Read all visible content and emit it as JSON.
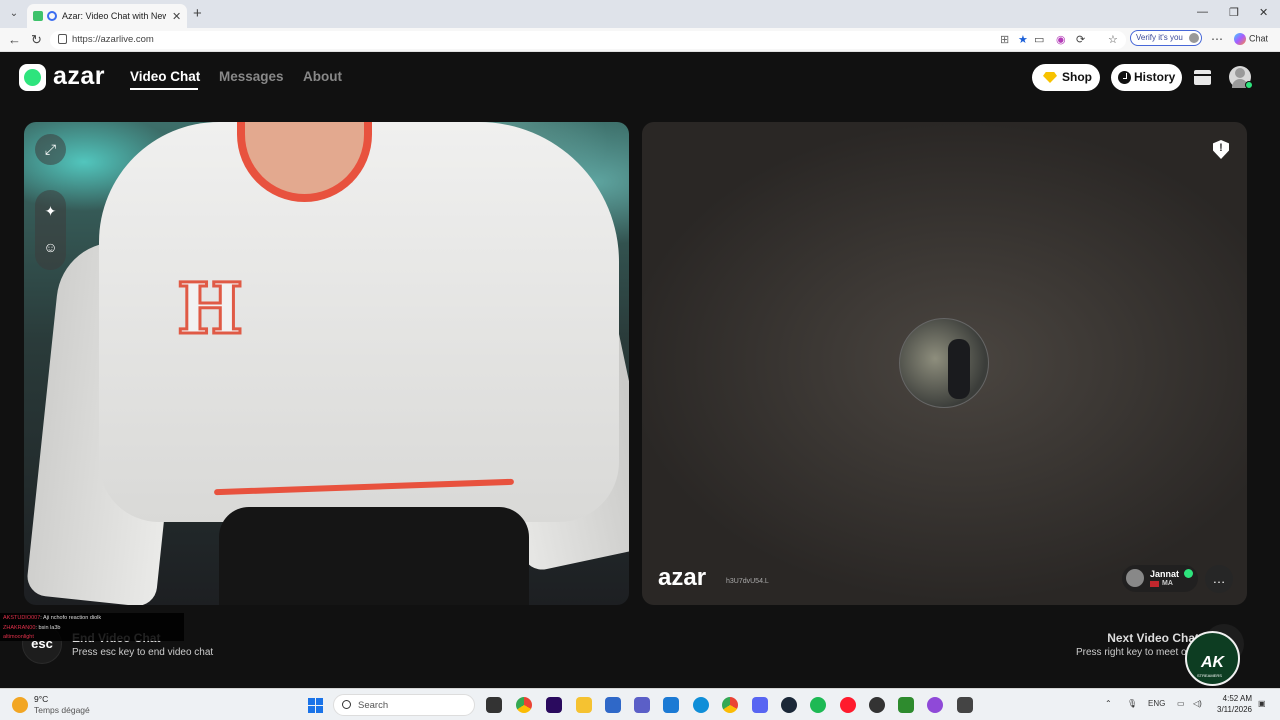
{
  "browser": {
    "tab_title": "Azar: Video Chat with New Pe",
    "tab_close": "✕",
    "new_tab": "+",
    "url": "https://azarlive.com",
    "verify_label": "Verify it's you",
    "chat_label": "Chat",
    "win_minimize": "—",
    "win_restore": "❐",
    "win_close": "✕"
  },
  "app": {
    "logo": "azar",
    "nav": [
      {
        "label": "Video Chat",
        "active": true
      },
      {
        "label": "Messages",
        "active": false
      },
      {
        "label": "About",
        "active": false
      }
    ],
    "shop_label": "Shop",
    "history_label": "History"
  },
  "remote": {
    "watermark": "azar",
    "session_id": "h3U7dvU54.L",
    "peer_name": "Jannat",
    "peer_country": "MA"
  },
  "controls": {
    "esc_key": "esc",
    "end_title": "End Video Chat",
    "end_sub": "Press esc key to end video chat",
    "next_title": "Next Video Chat",
    "next_sub": "Press right key to meet other"
  },
  "stream_chat": [
    {
      "user": "AKSTUDIO007",
      "msg": ": Aji nchofo reaction diolk"
    },
    {
      "user": "ZHAKRAN00",
      "msg": ": bsin la3b"
    },
    {
      "user": "altimoonlight",
      "msg": ""
    }
  ],
  "overlay": {
    "ak_logo": "AK",
    "ak_sub": "STREAMERS"
  },
  "taskbar": {
    "weather_temp": "9°C",
    "weather_desc": "Temps dégagé",
    "search_placeholder": "Search",
    "lang": "ENG",
    "time": "4:52 AM",
    "date": "3/11/2026"
  },
  "colors": {
    "azar_green": "#2ee47d",
    "background": "#111111",
    "accent_red": "#e8523e"
  }
}
